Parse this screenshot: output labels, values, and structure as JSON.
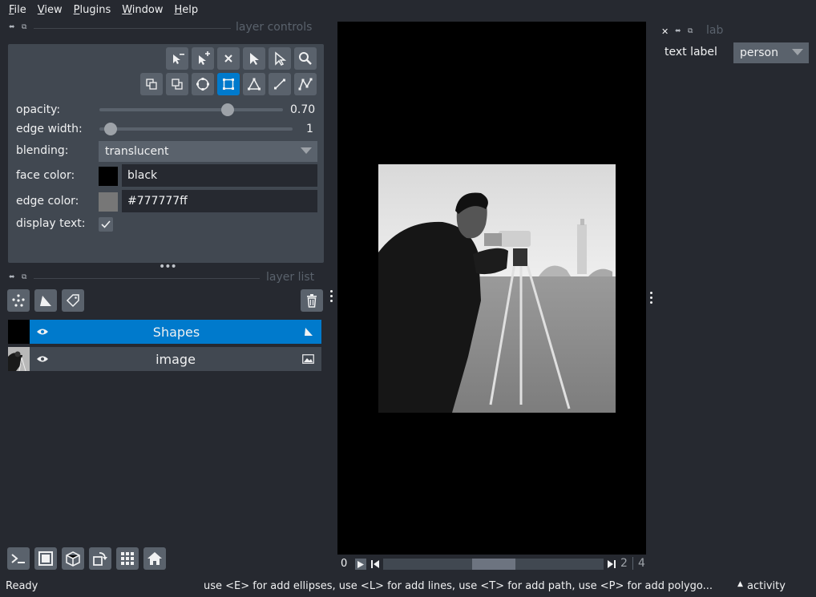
{
  "menubar": {
    "items": [
      {
        "label_u": "F",
        "label_rest": "ile"
      },
      {
        "label_u": "V",
        "label_rest": "iew"
      },
      {
        "label_u": "P",
        "label_rest": "lugins"
      },
      {
        "label_u": "W",
        "label_rest": "indow"
      },
      {
        "label_u": "H",
        "label_rest": "elp"
      }
    ]
  },
  "layer_controls": {
    "title": "layer controls",
    "opacity_label": "opacity:",
    "opacity_value": "0.70",
    "opacity_fraction": 0.7,
    "edge_width_label": "edge width:",
    "edge_width_value": "1",
    "blending_label": "blending:",
    "blending_value": "translucent",
    "face_color_label": "face color:",
    "face_color_value": "black",
    "face_color_hex": "#000000",
    "edge_color_label": "edge color:",
    "edge_color_value": "#777777ff",
    "edge_color_hex": "#777777",
    "display_text_label": "display text:",
    "display_text_checked": true
  },
  "layer_list": {
    "title": "layer list",
    "layers": [
      {
        "name": "Shapes",
        "selected": true,
        "type_icon": "shapes-icon"
      },
      {
        "name": "image",
        "selected": false,
        "type_icon": "image-icon"
      }
    ]
  },
  "right_dock": {
    "title": "lab",
    "text_label_label": "text label",
    "text_label_value": "person"
  },
  "dims_slider": {
    "axis_label": "0",
    "current": "2",
    "total": "4"
  },
  "status": {
    "left": "Ready",
    "hint": "use <E> for add ellipses, use <L> for add lines, use <T> for add path, use <P> for add polygo...",
    "activity": "activity"
  },
  "colors": {
    "background": "#262930",
    "panel": "#414851",
    "button": "#5a626c",
    "accent": "#007acc"
  }
}
